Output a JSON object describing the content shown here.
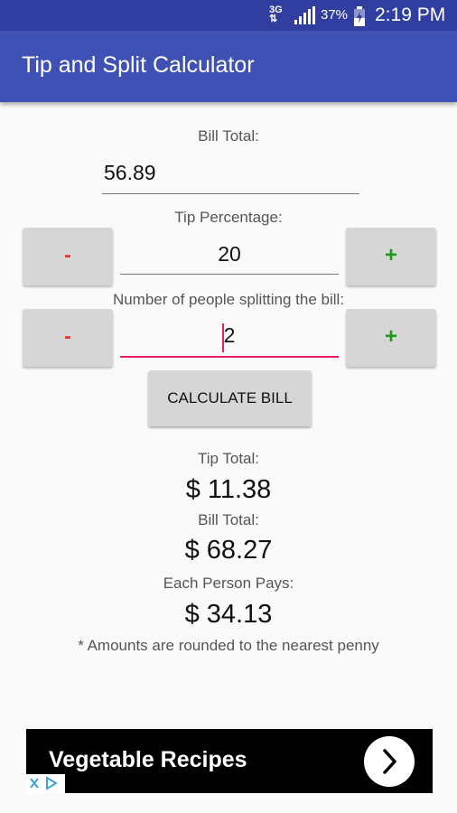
{
  "status_bar": {
    "network_top": "3G",
    "network_bottom": "⇅",
    "battery_percent": "37%",
    "time": "2:19 PM"
  },
  "app_bar": {
    "title": "Tip and Split Calculator"
  },
  "form": {
    "bill_total_label": "Bill Total:",
    "bill_total_value": "56.89",
    "tip_percentage_label": "Tip Percentage:",
    "tip_percentage_value": "20",
    "people_label": "Number of people splitting the bill:",
    "people_value": "2",
    "decrement_label": "-",
    "increment_label": "+",
    "calculate_label": "CALCULATE BILL"
  },
  "results": {
    "tip_total_label": "Tip Total:",
    "tip_total_value": "$ 11.38",
    "bill_total_label": "Bill Total:",
    "bill_total_value": "$ 68.27",
    "each_person_label": "Each Person Pays:",
    "each_person_value": "$ 34.13",
    "note": "* Amounts are rounded to the nearest penny"
  },
  "ad": {
    "text": "Vegetable Recipes",
    "arrow_icon": "chevron-right-icon"
  },
  "colors": {
    "status_bar": "#303f9f",
    "app_bar": "#3f51b5",
    "minus": "#e53935",
    "plus": "#1e9a1e",
    "focus_underline": "#e91e63"
  }
}
